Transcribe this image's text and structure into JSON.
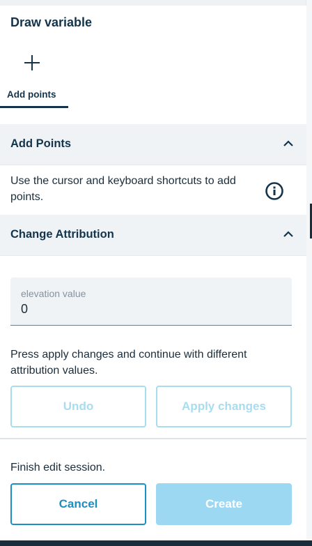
{
  "panel": {
    "title": "Draw variable"
  },
  "tools": [
    {
      "label": "Add points",
      "icon": "plus-icon",
      "active": true
    }
  ],
  "sections": {
    "add_points": {
      "title": "Add Points",
      "expanded": true,
      "description": "Use the cursor and keyboard shortcuts to add points.",
      "info_icon": "info-icon"
    },
    "change_attribution": {
      "title": "Change Attribution",
      "expanded": true,
      "field": {
        "label": "elevation value",
        "value": "0"
      },
      "hint": "Press apply changes and continue with different attribution values.",
      "undo_label": "Undo",
      "apply_label": "Apply changes"
    }
  },
  "footer": {
    "text": "Finish edit session.",
    "cancel_label": "Cancel",
    "create_label": "Create"
  },
  "colors": {
    "primary": "#13344a",
    "accent": "#1a8fc4",
    "disabled_accent": "#a8ddef",
    "section_bg": "#f0f3f6"
  }
}
